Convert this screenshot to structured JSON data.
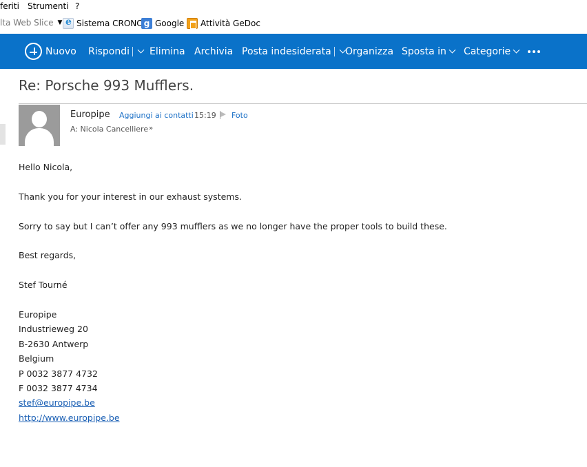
{
  "browser": {
    "menu": [
      "feriti",
      "Strumenti",
      "?"
    ],
    "favorites": [
      {
        "label": "lta Web Slice",
        "icon": "dropdown-caret"
      },
      {
        "label": "Sistema CRONO",
        "icon": "ie-page-icon"
      },
      {
        "label": "Google",
        "icon": "google-icon"
      },
      {
        "label": "Attività GeDoc",
        "icon": "gedoc-icon"
      }
    ]
  },
  "toolbar": {
    "new_label": "Nuovo",
    "reply_label": "Rispondi",
    "delete_label": "Elimina",
    "archive_label": "Archivia",
    "junk_label": "Posta indesiderata",
    "organize_label": "Organizza",
    "move_label": "Sposta in",
    "categories_label": "Categorie",
    "colors": {
      "background": "#0a72c9",
      "text": "#ffffff"
    }
  },
  "message": {
    "subject": "Re: Porsche 993 Mufflers.",
    "sender": "Europipe",
    "add_contact": "Aggiungi ai contatti",
    "time": "15:19",
    "photo": "Foto",
    "recipient": "A: Nicola Cancelliere",
    "body": {
      "greeting": "Hello Nicola,",
      "p1": "Thank you for your interest in our exhaust systems.",
      "p2": "Sorry to say but I can’t offer any 993 mufflers as we no longer have the proper tools to build these.",
      "closing": "Best regards,",
      "signer": "Stef Tourné",
      "signature": {
        "company": "Europipe",
        "street": "Industrieweg 20",
        "city": "B-2630 Antwerp",
        "country": "Belgium",
        "phone": "P 0032 3877 4732",
        "fax": "F 0032 3877 4734",
        "email": "stef@europipe.be",
        "website": "http://www.europipe.be"
      }
    }
  }
}
